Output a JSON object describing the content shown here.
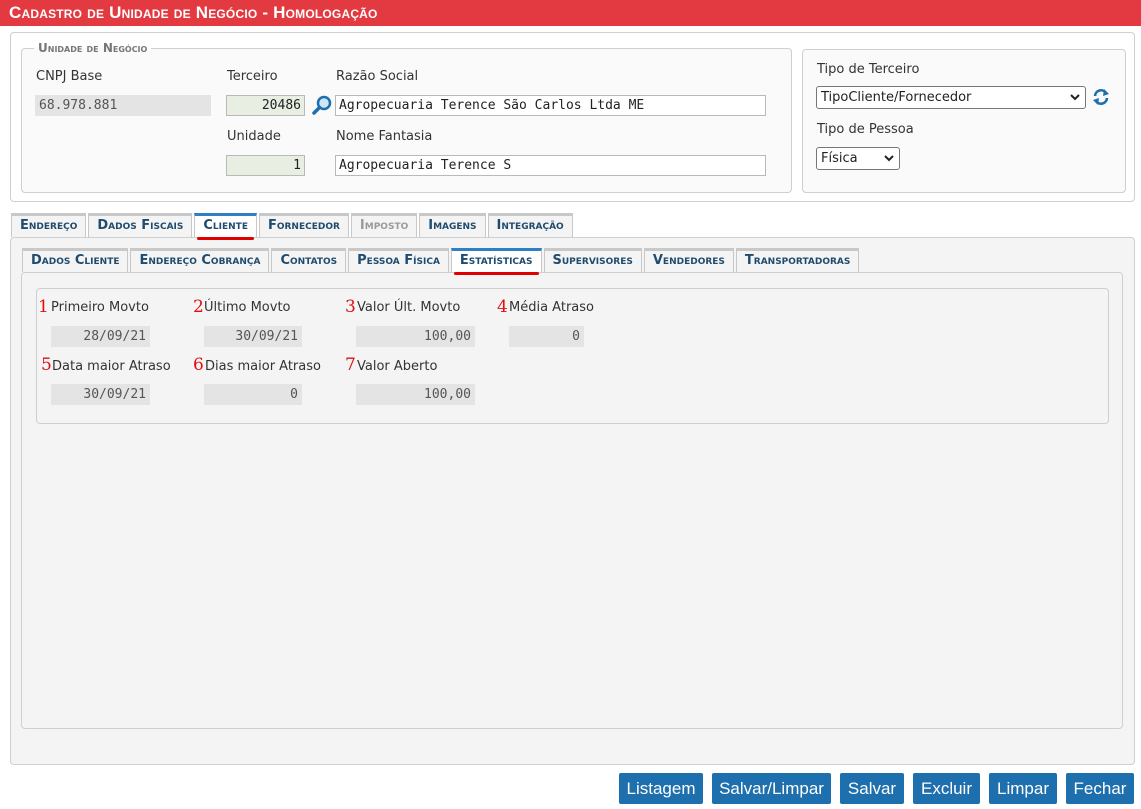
{
  "title": "Cadastro de Unidade de Negócio  - Homologação",
  "unidade": {
    "legend": "Unidade de Negócio",
    "cnpj_label": "CNPJ Base",
    "cnpj_value": "68.978.881",
    "terceiro_label": "Terceiro",
    "terceiro_value": "20486",
    "razao_label": "Razão Social",
    "razao_value": "Agropecuaria Terence São Carlos Ltda ME",
    "unidade_label": "Unidade",
    "unidade_value": "1",
    "fantasia_label": "Nome Fantasia",
    "fantasia_value": "Agropecuaria Terence S"
  },
  "tipo": {
    "terceiro_label": "Tipo de Terceiro",
    "terceiro_value": "TipoCliente/Fornecedor",
    "pessoa_label": "Tipo de Pessoa",
    "pessoa_value": "Física"
  },
  "tabs": [
    "Endereço",
    "Dados Fiscais",
    "Cliente",
    "Fornecedor",
    "Imposto",
    "Imagens",
    "Integração"
  ],
  "subtabs": [
    "Dados Cliente",
    "Endereço Cobrança",
    "Contatos",
    "Pessoa Física",
    "Estatísticas",
    "Supervisores",
    "Vendedores",
    "Transportadoras"
  ],
  "stats": {
    "primeiro_label": "Primeiro Movto",
    "primeiro_value": "28/09/21",
    "ultimo_label": "Último Movto",
    "ultimo_value": "30/09/21",
    "valor_ult_label": "Valor Últ. Movto",
    "valor_ult_value": "100,00",
    "media_label": "Média Atraso",
    "media_value": "0",
    "data_maior_label": "Data maior Atraso",
    "data_maior_value": "30/09/21",
    "dias_maior_label": "Dias maior Atraso",
    "dias_maior_value": "0",
    "valor_aberto_label": "Valor Aberto",
    "valor_aberto_value": "100,00"
  },
  "markers": [
    "1",
    "2",
    "3",
    "4",
    "5",
    "6",
    "7"
  ],
  "buttons": {
    "listagem": "Listagem",
    "salvar_limpar": "Salvar/Limpar",
    "salvar": "Salvar",
    "excluir": "Excluir",
    "limpar": "Limpar",
    "fechar": "Fechar"
  },
  "icons": [
    "search-icon",
    "refresh-icon",
    "chevron-down-icon"
  ],
  "colors": {
    "title_bar": "#e33a41",
    "tab_text": "#1f4b6e",
    "active_tab_top": "#2f7fc4",
    "underline": "#e00000",
    "button": "#1d6fad",
    "marker": "#e01010"
  }
}
